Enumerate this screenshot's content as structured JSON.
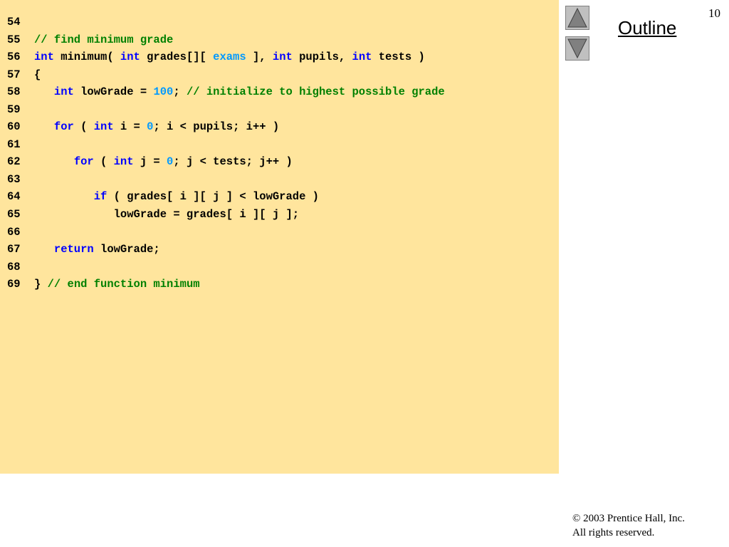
{
  "slide": {
    "page_number": "10",
    "outline_label": "Outline",
    "copyright_line1": "© 2003 Prentice Hall, Inc.",
    "copyright_line2": "All rights reserved."
  },
  "navigation": {
    "up_icon": "triangle-up-icon",
    "down_icon": "triangle-down-icon"
  },
  "colors": {
    "code_background": "#ffe59d",
    "keyword": "#0000ff",
    "comment": "#008000",
    "literal": "#0099ff",
    "plain_text": "#000000"
  },
  "code_lines": [
    {
      "number": "54",
      "tokens": []
    },
    {
      "number": "55",
      "tokens": [
        {
          "t": "// find minimum grade",
          "c": "cm"
        }
      ]
    },
    {
      "number": "56",
      "tokens": [
        {
          "t": "int",
          "c": "kw"
        },
        {
          "t": " minimum( ",
          "c": ""
        },
        {
          "t": "int",
          "c": "kw"
        },
        {
          "t": " grades[][ ",
          "c": ""
        },
        {
          "t": "exams",
          "c": "id"
        },
        {
          "t": " ], ",
          "c": ""
        },
        {
          "t": "int",
          "c": "kw"
        },
        {
          "t": " pupils, ",
          "c": ""
        },
        {
          "t": "int",
          "c": "kw"
        },
        {
          "t": " tests )",
          "c": ""
        }
      ]
    },
    {
      "number": "57",
      "tokens": [
        {
          "t": "{",
          "c": ""
        }
      ]
    },
    {
      "number": "58",
      "tokens": [
        {
          "t": "   ",
          "c": ""
        },
        {
          "t": "int",
          "c": "kw"
        },
        {
          "t": " lowGrade = ",
          "c": ""
        },
        {
          "t": "100",
          "c": "num"
        },
        {
          "t": "; ",
          "c": ""
        },
        {
          "t": "// initialize to highest possible grade",
          "c": "cm"
        }
      ]
    },
    {
      "number": "59",
      "tokens": []
    },
    {
      "number": "60",
      "tokens": [
        {
          "t": "   ",
          "c": ""
        },
        {
          "t": "for",
          "c": "kw"
        },
        {
          "t": " ( ",
          "c": ""
        },
        {
          "t": "int",
          "c": "kw"
        },
        {
          "t": " i = ",
          "c": ""
        },
        {
          "t": "0",
          "c": "num"
        },
        {
          "t": "; i < pupils; i++ )",
          "c": ""
        }
      ]
    },
    {
      "number": "61",
      "tokens": []
    },
    {
      "number": "62",
      "tokens": [
        {
          "t": "      ",
          "c": ""
        },
        {
          "t": "for",
          "c": "kw"
        },
        {
          "t": " ( ",
          "c": ""
        },
        {
          "t": "int",
          "c": "kw"
        },
        {
          "t": " j = ",
          "c": ""
        },
        {
          "t": "0",
          "c": "num"
        },
        {
          "t": "; j < tests; j++ )",
          "c": ""
        }
      ]
    },
    {
      "number": "63",
      "tokens": []
    },
    {
      "number": "64",
      "tokens": [
        {
          "t": "         ",
          "c": ""
        },
        {
          "t": "if",
          "c": "kw"
        },
        {
          "t": " ( grades[ i ][ j ] < lowGrade )",
          "c": ""
        }
      ]
    },
    {
      "number": "65",
      "tokens": [
        {
          "t": "            lowGrade = grades[ i ][ j ];",
          "c": ""
        }
      ]
    },
    {
      "number": "66",
      "tokens": []
    },
    {
      "number": "67",
      "tokens": [
        {
          "t": "   ",
          "c": ""
        },
        {
          "t": "return",
          "c": "kw"
        },
        {
          "t": " lowGrade;",
          "c": ""
        }
      ]
    },
    {
      "number": "68",
      "tokens": []
    },
    {
      "number": "69",
      "tokens": [
        {
          "t": "} ",
          "c": ""
        },
        {
          "t": "// end function minimum",
          "c": "cm"
        }
      ]
    }
  ]
}
